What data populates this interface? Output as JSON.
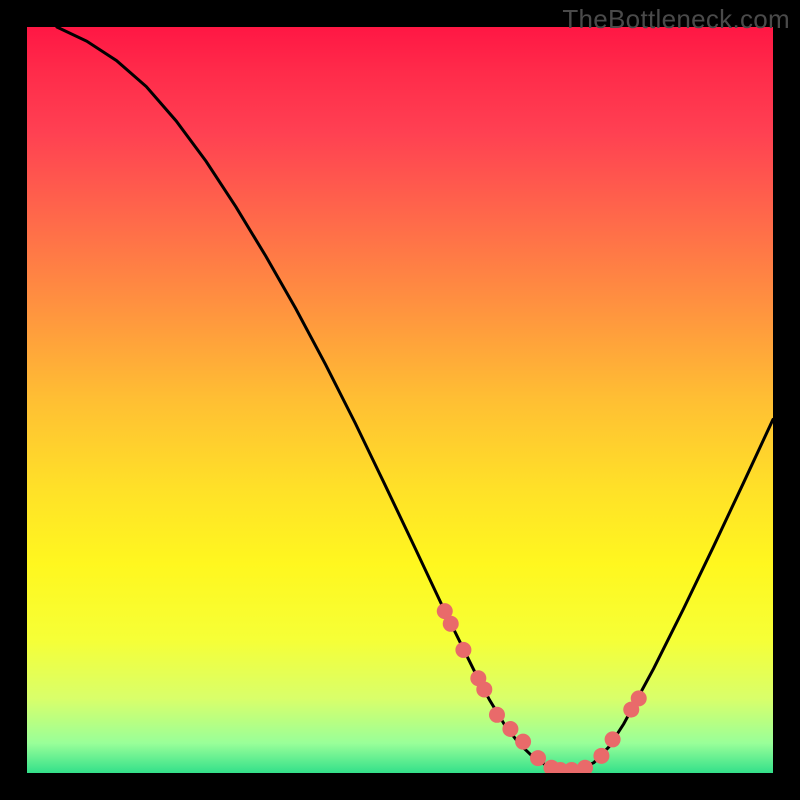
{
  "watermark": "TheBottleneck.com",
  "chart_data": {
    "type": "line",
    "title": "",
    "xlabel": "",
    "ylabel": "",
    "xlim": [
      0,
      100
    ],
    "ylim": [
      0,
      100
    ],
    "grid": false,
    "legend": false,
    "curve_x": [
      4,
      8,
      12,
      16,
      20,
      24,
      28,
      32,
      36,
      40,
      44,
      48,
      52,
      56,
      60,
      62,
      64,
      66,
      68,
      70,
      72,
      74,
      76,
      78,
      80,
      84,
      88,
      92,
      96,
      100
    ],
    "curve_y": [
      100,
      98.1,
      95.5,
      92.0,
      87.4,
      82.0,
      75.9,
      69.3,
      62.3,
      54.8,
      46.9,
      38.6,
      30.2,
      21.7,
      13.6,
      9.8,
      6.5,
      3.9,
      2.0,
      0.8,
      0.3,
      0.4,
      1.4,
      3.5,
      6.6,
      14.0,
      22.0,
      30.3,
      38.8,
      47.4
    ],
    "dots_x": [
      56.0,
      56.8,
      58.5,
      60.5,
      61.3,
      63.0,
      64.8,
      66.5,
      68.5,
      70.3,
      71.5,
      73.0,
      74.8,
      77.0,
      78.5,
      81.0,
      82.0
    ],
    "dots_y": [
      21.7,
      20.0,
      16.5,
      12.7,
      11.2,
      7.8,
      5.9,
      4.2,
      2.0,
      0.7,
      0.4,
      0.4,
      0.7,
      2.3,
      4.5,
      8.5,
      10.0
    ],
    "dot_color": "#e96a6a"
  }
}
